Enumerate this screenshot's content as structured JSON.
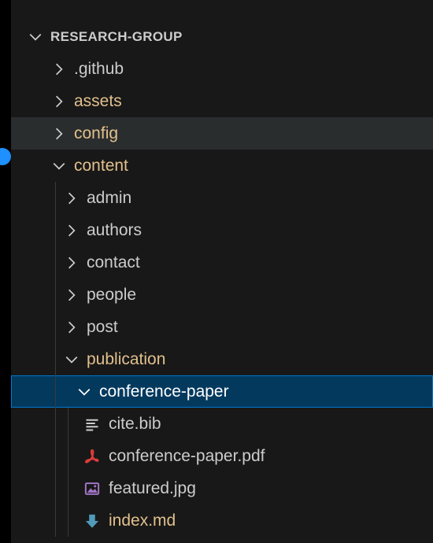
{
  "explorer": {
    "root": {
      "label": "RESEARCH-GROUP",
      "expanded": true
    },
    "items": [
      {
        "label": ".github",
        "type": "folder",
        "expanded": false
      },
      {
        "label": "assets",
        "type": "folder",
        "expanded": false
      },
      {
        "label": "config",
        "type": "folder",
        "expanded": false,
        "state": "hovered"
      },
      {
        "label": "content",
        "type": "folder",
        "expanded": true
      },
      {
        "label": "admin",
        "type": "folder",
        "expanded": false
      },
      {
        "label": "authors",
        "type": "folder",
        "expanded": false
      },
      {
        "label": "contact",
        "type": "folder",
        "expanded": false
      },
      {
        "label": "people",
        "type": "folder",
        "expanded": false
      },
      {
        "label": "post",
        "type": "folder",
        "expanded": false
      },
      {
        "label": "publication",
        "type": "folder",
        "expanded": true
      },
      {
        "label": "conference-paper",
        "type": "folder",
        "expanded": true,
        "state": "selected"
      },
      {
        "label": "cite.bib",
        "type": "file",
        "icon": "text-lines-icon"
      },
      {
        "label": "conference-paper.pdf",
        "type": "file",
        "icon": "pdf-icon"
      },
      {
        "label": "featured.jpg",
        "type": "file",
        "icon": "image-icon"
      },
      {
        "label": "index.md",
        "type": "file",
        "icon": "markdown-icon"
      }
    ]
  },
  "colors": {
    "background": "#181818",
    "hover": "#2a2d2e",
    "selected": "#04395e",
    "selected_border": "#0078d4",
    "modified_text": "#e2c08d",
    "pdf_icon": "#e03c3c",
    "image_icon": "#a074c4",
    "markdown_icon": "#519aba",
    "accent_dot": "#1e90ff"
  }
}
